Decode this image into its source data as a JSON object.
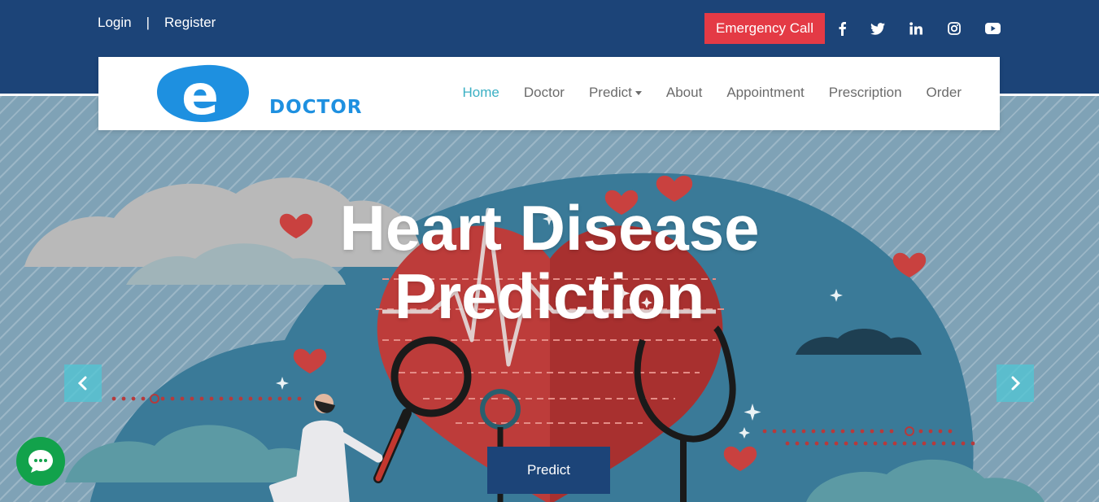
{
  "header": {
    "login_label": "Login",
    "separator": "|",
    "register_label": "Register",
    "emergency_label": "Emergency Call",
    "social_icons": [
      "facebook-icon",
      "twitter-icon",
      "linkedin-icon",
      "instagram-icon",
      "youtube-icon"
    ]
  },
  "brand": {
    "logo_letter": "e",
    "logo_word": "DOCTOR"
  },
  "nav": {
    "items": [
      {
        "label": "Home",
        "active": true
      },
      {
        "label": "Doctor"
      },
      {
        "label": "Predict",
        "dropdown": true
      },
      {
        "label": "About"
      },
      {
        "label": "Appointment"
      },
      {
        "label": "Prescription"
      },
      {
        "label": "Order"
      }
    ]
  },
  "hero": {
    "title_line1": "Heart Disease",
    "title_line2": "Prediction",
    "button_label": "Predict"
  },
  "colors": {
    "topbar": "#1c4478",
    "emergency": "#e43a45",
    "nav_active": "#3bb0c4",
    "logo_blue": "#1e90e0",
    "chat_green": "#12a24b",
    "carousel_arrow": "#4fc5d4"
  }
}
